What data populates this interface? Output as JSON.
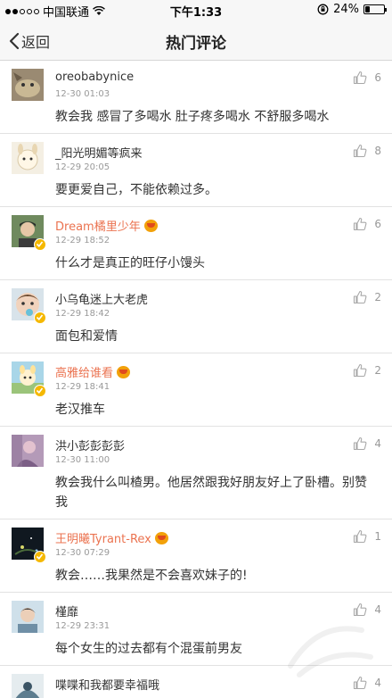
{
  "status_bar": {
    "carrier": "中国联通",
    "time": "下午1:33",
    "battery": "24%",
    "battery_level": 0.24,
    "signal_bars_filled": 2,
    "signal_bars_total": 5
  },
  "nav": {
    "back_label": "返回",
    "title": "热门评论"
  },
  "comments": [
    {
      "name": "oreobabynice",
      "date": "12-30 01:03",
      "text": "教会我 感冒了多喝水 肚子疼多喝水 不舒服多喝水",
      "likes": "6",
      "verified": false,
      "vip": false
    },
    {
      "name": "_阳光明媚等疯来",
      "date": "12-29 20:05",
      "text": "要更爱自己，不能依赖过多。",
      "likes": "8",
      "verified": false,
      "vip": false
    },
    {
      "name": "Dream橘里少年",
      "date": "12-29 18:52",
      "text": "什么才是真正的旺仔小馒头",
      "likes": "6",
      "verified": true,
      "vip": true
    },
    {
      "name": "小乌龟迷上大老虎",
      "date": "12-29 18:42",
      "text": "面包和爱情",
      "likes": "2",
      "verified": true,
      "vip": false
    },
    {
      "name": "高雅给谁看",
      "date": "12-29 18:41",
      "text": "老汉推车",
      "likes": "2",
      "verified": true,
      "vip": true
    },
    {
      "name": "洪小彭彭彭彭",
      "date": "12-30 11:00",
      "text": "教会我什么叫楂男。他居然跟我好朋友好上了卧槽。别赞我",
      "likes": "4",
      "verified": false,
      "vip": false
    },
    {
      "name": "王明曦Tyrant-Rex",
      "date": "12-30 07:29",
      "text": "教会……我果然是不会喜欢妹子的!",
      "likes": "1",
      "verified": true,
      "vip": true
    },
    {
      "name": "槿靡",
      "date": "12-29 23:31",
      "text": "每个女生的过去都有个混蛋前男友",
      "likes": "4",
      "verified": false,
      "vip": false
    },
    {
      "name": "喋喋和我都要幸福哦",
      "date": "",
      "text": "",
      "likes": "4",
      "verified": false,
      "vip": false
    }
  ],
  "colors": {
    "vip_name": "#eb7350",
    "verified_badge": "#f5b800",
    "muted": "#999999"
  }
}
